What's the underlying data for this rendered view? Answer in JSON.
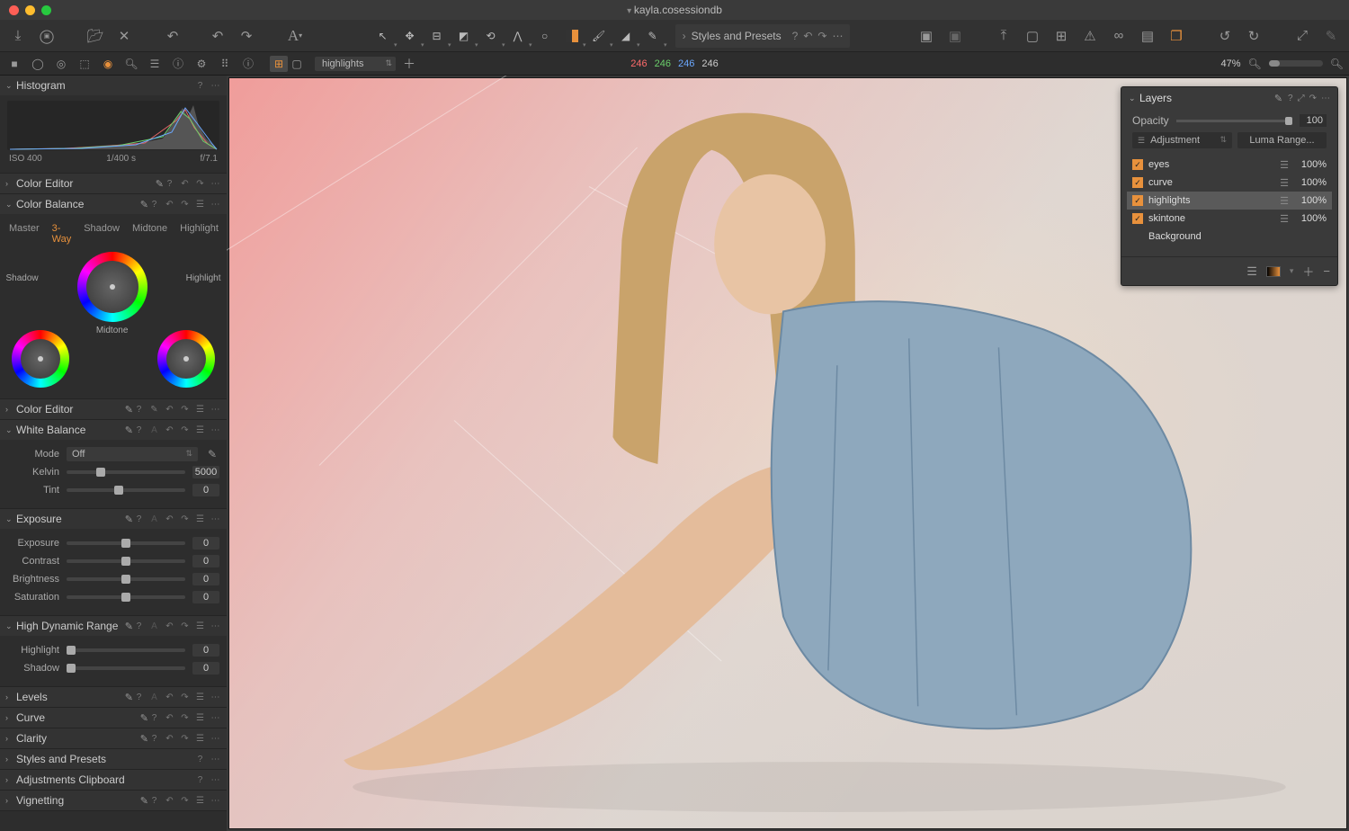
{
  "title": "kayla.cosessiondb",
  "styles_bar": "Styles and Presets",
  "zoom": "47%",
  "rgb": {
    "r": "246",
    "g": "246",
    "b": "246",
    "w": "246"
  },
  "layer_select": "highlights",
  "histogram": {
    "title": "Histogram",
    "iso": "ISO 400",
    "shutter": "1/400 s",
    "aperture": "f/7.1"
  },
  "color_editor": {
    "title": "Color Editor"
  },
  "color_balance": {
    "title": "Color Balance",
    "tabs": [
      "Master",
      "3-Way",
      "Shadow",
      "Midtone",
      "Highlight"
    ],
    "active": 1,
    "wheels": {
      "shadow": "Shadow",
      "midtone": "Midtone",
      "highlight": "Highlight"
    }
  },
  "color_editor2": {
    "title": "Color Editor"
  },
  "white_balance": {
    "title": "White Balance",
    "mode_label": "Mode",
    "mode_value": "Off",
    "kelvin_label": "Kelvin",
    "kelvin_value": "5000",
    "tint_label": "Tint",
    "tint_value": "0"
  },
  "exposure": {
    "title": "Exposure",
    "rows": [
      {
        "label": "Exposure",
        "value": "0"
      },
      {
        "label": "Contrast",
        "value": "0"
      },
      {
        "label": "Brightness",
        "value": "0"
      },
      {
        "label": "Saturation",
        "value": "0"
      }
    ]
  },
  "hdr": {
    "title": "High Dynamic Range",
    "rows": [
      {
        "label": "Highlight",
        "value": "0"
      },
      {
        "label": "Shadow",
        "value": "0"
      }
    ]
  },
  "levels": {
    "title": "Levels"
  },
  "curve": {
    "title": "Curve"
  },
  "clarity": {
    "title": "Clarity"
  },
  "styles_presets": {
    "title": "Styles and Presets"
  },
  "adj_clipboard": {
    "title": "Adjustments Clipboard"
  },
  "vignetting": {
    "title": "Vignetting"
  },
  "layers_panel": {
    "title": "Layers",
    "opacity_label": "Opacity",
    "opacity_value": "100",
    "adjustment": "Adjustment",
    "luma": "Luma Range...",
    "items": [
      {
        "name": "eyes",
        "pct": "100%"
      },
      {
        "name": "curve",
        "pct": "100%"
      },
      {
        "name": "highlights",
        "pct": "100%",
        "selected": true
      },
      {
        "name": "skintone",
        "pct": "100%"
      },
      {
        "name": "Background",
        "bg": true
      }
    ]
  }
}
